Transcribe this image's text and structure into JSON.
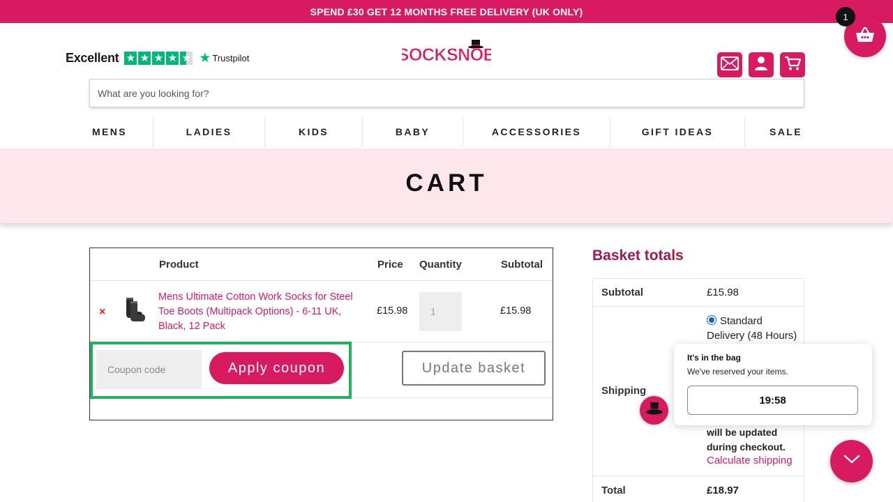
{
  "promo": {
    "text": "SPEND £30 GET 12 MONTHS FREE DELIVERY (UK ONLY)"
  },
  "trustpilot": {
    "rating_word": "Excellent",
    "brand": "Trustpilot",
    "stars": 4.5
  },
  "logo": {
    "text": "SOCKSNOB"
  },
  "header": {
    "icons": [
      "envelope-icon",
      "user-icon",
      "cart-icon"
    ],
    "basket_count": "1"
  },
  "search": {
    "placeholder": "What are you looking for?"
  },
  "nav": {
    "items": [
      "MENS",
      "LADIES",
      "KIDS",
      "BABY",
      "ACCESSORIES",
      "GIFT IDEAS",
      "SALE"
    ]
  },
  "hero": {
    "title": "CART"
  },
  "cart": {
    "headers": {
      "product": "Product",
      "price": "Price",
      "quantity": "Quantity",
      "subtotal": "Subtotal"
    },
    "items": [
      {
        "remove": "×",
        "name": "Mens Ultimate Cotton Work Socks for Steel Toe Boots (Multipack Options) - 6-11 UK, Black, 12 Pack",
        "price": "£15.98",
        "quantity": "1",
        "subtotal": "£15.98"
      }
    ],
    "coupon_placeholder": "Coupon code",
    "apply_label": "Apply coupon",
    "update_label": "Update basket"
  },
  "totals": {
    "title": "Basket totals",
    "subtotal_label": "Subtotal",
    "subtotal_value": "£15.98",
    "shipping_label": "Shipping",
    "shipping_option": "Standard Delivery (48 Hours)",
    "shipping_note": "will be updated during checkout.",
    "calc_link": "Calculate shipping",
    "total_label": "Total",
    "total_value": "£18.97"
  },
  "bag_popup": {
    "title": "It's in the bag",
    "subtitle": "We've reserved your items.",
    "timer": "19:58"
  },
  "colors": {
    "brand": "#d81b60",
    "hero_bg": "#fde7ec",
    "highlight": "#20b55a",
    "trustpilot": "#00b67a"
  }
}
